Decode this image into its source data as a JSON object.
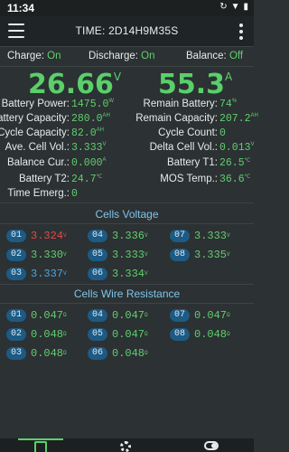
{
  "status_bar": {
    "time": "11:34",
    "icons": [
      "sync-icon",
      "wifi-icon",
      "battery-icon"
    ]
  },
  "app_bar": {
    "title": "TIME: 2D14H9M35S"
  },
  "switches": {
    "charge": {
      "label": "Charge:",
      "value": "On"
    },
    "discharge": {
      "label": "Discharge:",
      "value": "On"
    },
    "balance": {
      "label": "Balance:",
      "value": "Off"
    }
  },
  "primary": {
    "voltage": {
      "value": "26.66",
      "unit": "V"
    },
    "current": {
      "value": "55.3",
      "unit": "A"
    }
  },
  "stats_left": [
    {
      "label": "Battery Power:",
      "value": "1475.0",
      "unit": "W"
    },
    {
      "label": "Battery Capacity:",
      "value": "280.0",
      "unit": "AH"
    },
    {
      "label": "Cycle Capacity:",
      "value": "82.0",
      "unit": "AH"
    },
    {
      "label": "Ave. Cell Vol.:",
      "value": "3.333",
      "unit": "V"
    },
    {
      "label": "Balance Cur.:",
      "value": "0.000",
      "unit": "A"
    },
    {
      "label": "Battery T2:",
      "value": "24.7",
      "unit": "℃"
    },
    {
      "label": "Time Emerg.:",
      "value": "0",
      "unit": ""
    }
  ],
  "stats_right": [
    {
      "label": "Remain Battery:",
      "value": "74",
      "unit": "%"
    },
    {
      "label": "Remain Capacity:",
      "value": "207.2",
      "unit": "AH"
    },
    {
      "label": "Cycle Count:",
      "value": "0",
      "unit": ""
    },
    {
      "label": "Delta Cell Vol.:",
      "value": "0.013",
      "unit": "V"
    },
    {
      "label": "Battery T1:",
      "value": "26.5",
      "unit": "℃"
    },
    {
      "label": "MOS Temp.:",
      "value": "36.6",
      "unit": "℃"
    }
  ],
  "cells_voltage": {
    "title": "Cells Voltage",
    "cells": [
      {
        "id": "01",
        "value": "3.324",
        "unit": "V",
        "state": "hi"
      },
      {
        "id": "04",
        "value": "3.336",
        "unit": "V",
        "state": ""
      },
      {
        "id": "07",
        "value": "3.333",
        "unit": "V",
        "state": ""
      },
      {
        "id": "02",
        "value": "3.330",
        "unit": "V",
        "state": ""
      },
      {
        "id": "05",
        "value": "3.333",
        "unit": "V",
        "state": ""
      },
      {
        "id": "08",
        "value": "3.335",
        "unit": "V",
        "state": ""
      },
      {
        "id": "03",
        "value": "3.337",
        "unit": "V",
        "state": "lo"
      },
      {
        "id": "06",
        "value": "3.334",
        "unit": "V",
        "state": ""
      }
    ]
  },
  "cells_resistance": {
    "title": "Cells Wire Resistance",
    "cells": [
      {
        "id": "01",
        "value": "0.047",
        "unit": "Ω"
      },
      {
        "id": "04",
        "value": "0.047",
        "unit": "Ω"
      },
      {
        "id": "07",
        "value": "0.047",
        "unit": "Ω"
      },
      {
        "id": "02",
        "value": "0.048",
        "unit": "Ω"
      },
      {
        "id": "05",
        "value": "0.047",
        "unit": "Ω"
      },
      {
        "id": "08",
        "value": "0.048",
        "unit": "Ω"
      },
      {
        "id": "03",
        "value": "0.048",
        "unit": "Ω"
      },
      {
        "id": "06",
        "value": "0.048",
        "unit": "Ω"
      }
    ]
  },
  "colors": {
    "accent_green": "#59d06a",
    "badge_blue": "#1d5a84",
    "title_blue": "#7fc4e9",
    "alert_red": "#e24a47",
    "low_blue": "#4ba6e4"
  },
  "bottom_nav": [
    "dashboard-icon",
    "settings-icon",
    "toggle-icon"
  ]
}
